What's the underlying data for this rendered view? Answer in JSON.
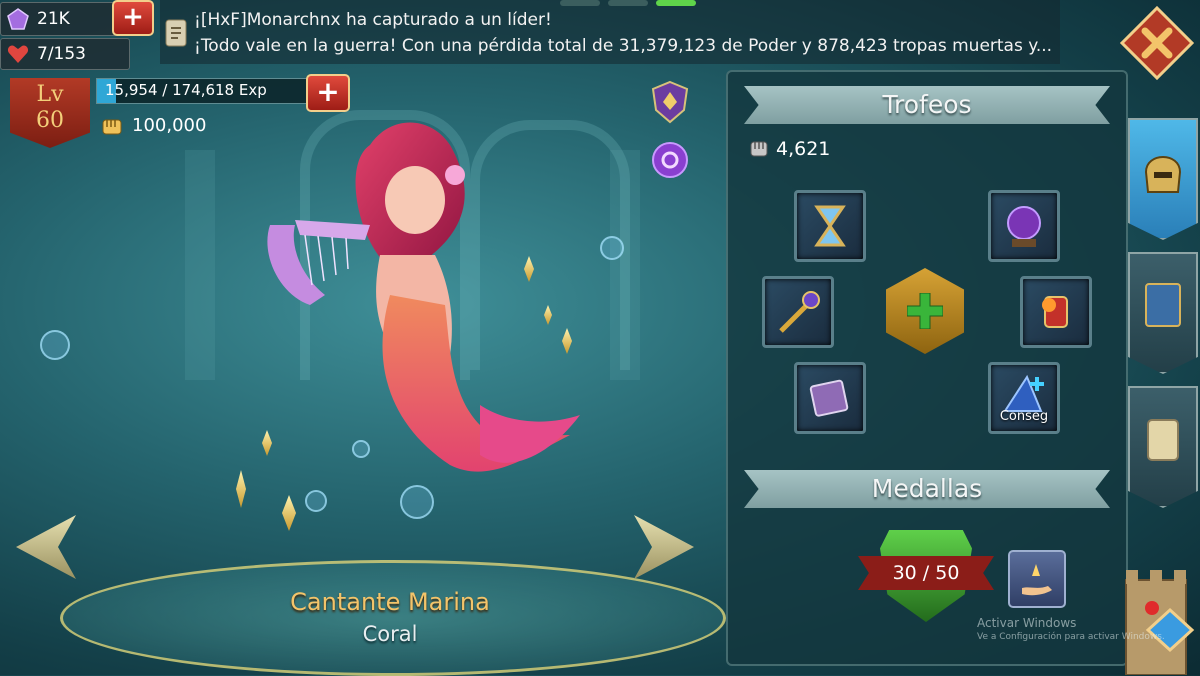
{
  "resources": {
    "gems": "21K",
    "stamina": "7/153"
  },
  "chat": {
    "line1": "¡[HxF]Monarchnx ha capturado a un líder!",
    "line2": "¡Todo vale en la guerra!  Con una pérdida total de 31,379,123 de Poder y 878,423 tropas muertas y..."
  },
  "hero": {
    "level_label": "Lv",
    "level": "60",
    "exp_text": "15,954 / 174,618 Exp",
    "exp_fraction": 0.091,
    "might": "100,000",
    "name": "Cantante Marina",
    "type": "Coral"
  },
  "trophies": {
    "title": "Trofeos",
    "count": "4,621",
    "slot_labels": {
      "wizard_hat": "Conseg"
    }
  },
  "medals": {
    "title": "Medallas",
    "progress": "30 / 50"
  },
  "system": {
    "watermark_title": "Activar Windows",
    "watermark_sub": "Ve a Configuración para activar Windows."
  },
  "colors": {
    "accent_gold": "#f3c46a",
    "panel": "#14373e",
    "exp_blue": "#2fa7d6"
  }
}
